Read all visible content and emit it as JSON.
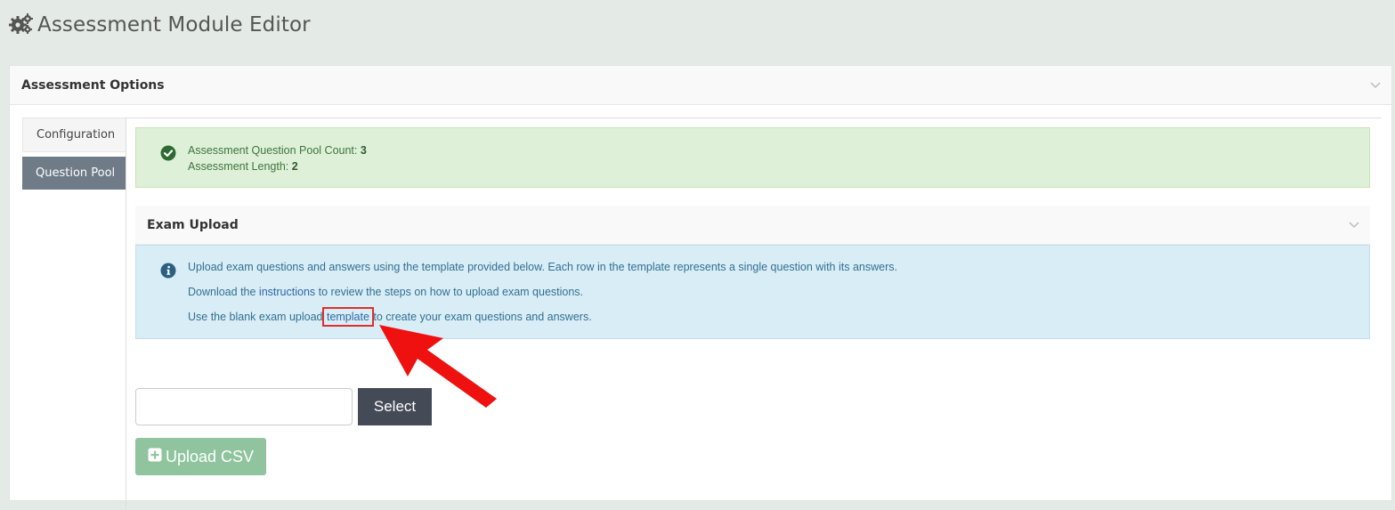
{
  "header": {
    "title": "Assessment Module Editor",
    "icon": "gears-icon"
  },
  "panel": {
    "title": "Assessment Options"
  },
  "tabs": [
    {
      "label": "Configuration",
      "active": false
    },
    {
      "label": "Question Pool",
      "active": true
    }
  ],
  "summary": {
    "pool_count_label": "Assessment Question Pool Count: ",
    "pool_count_value": "3",
    "length_label": "Assessment Length: ",
    "length_value": "2"
  },
  "exam_upload": {
    "title": "Exam Upload",
    "line1": "Upload exam questions and answers using the template provided below. Each row in the template represents a single question with its answers.",
    "line2_before": "Download the ",
    "line2_link": "instructions",
    "line2_after": " to review the steps on how to upload exam questions.",
    "line3_before": "Use the blank exam upload ",
    "line3_link": "template",
    "line3_after": " to create your exam questions and answers.",
    "file_value": "",
    "select_label": "Select",
    "upload_label": "Upload CSV"
  },
  "colors": {
    "success_bg": "#dff0d8",
    "info_bg": "#d9edf7",
    "active_tab": "#6f7b86",
    "annotation": "#e0302a"
  }
}
